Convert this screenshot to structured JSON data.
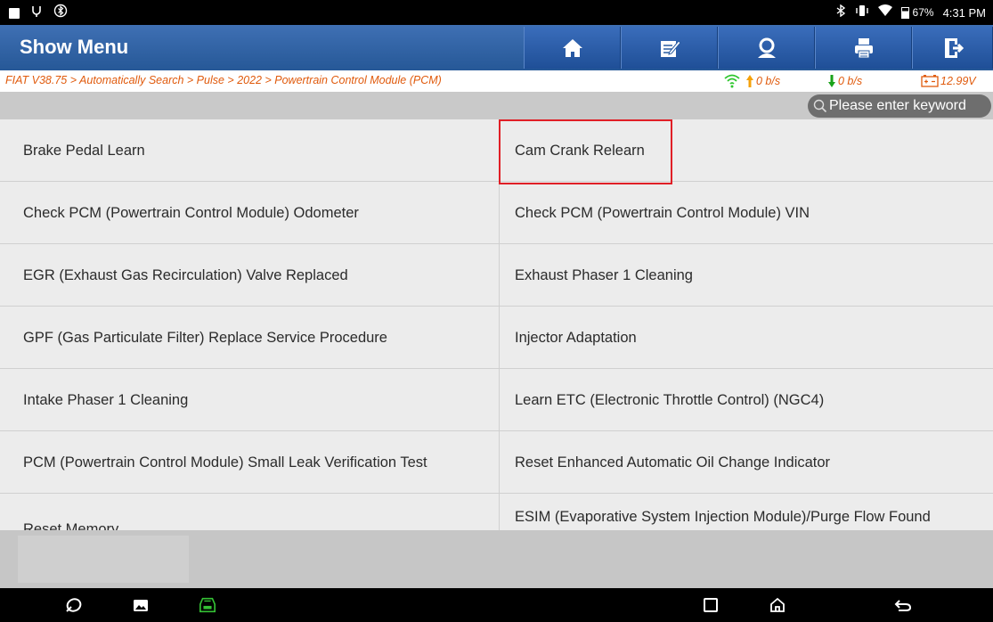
{
  "status_bar": {
    "icons_left": [
      "image-notification-icon",
      "usb-icon",
      "bluetooth-settings-icon"
    ],
    "icons_right": [
      "bluetooth-icon",
      "vibrate-icon",
      "wifi-icon",
      "battery-icon"
    ],
    "battery": "67%",
    "time": "4:31 PM"
  },
  "header": {
    "title": "Show Menu",
    "buttons": [
      "home-icon",
      "edit-report-icon",
      "user-icon",
      "print-icon",
      "exit-icon"
    ],
    "accent": "#2c5ea4"
  },
  "breadcrumb": {
    "path": "FIAT V38.75 > Automatically Search > Pulse > 2022 > Powertrain Control Module (PCM)",
    "upload_rate": "0 b/s",
    "download_rate": "0 b/s",
    "voltage": "12.99V",
    "color": "#e05a0c"
  },
  "search": {
    "placeholder": "Please enter keyword",
    "value": ""
  },
  "menu": {
    "items": [
      "Brake Pedal Learn",
      "Cam Crank Relearn",
      "Check PCM (Powertrain Control Module) Odometer",
      "Check PCM (Powertrain Control Module) VIN",
      "EGR (Exhaust Gas Recirculation) Valve Replaced",
      "Exhaust Phaser 1 Cleaning",
      "GPF (Gas Particulate Filter) Replace Service Procedure",
      "Injector Adaptation",
      "Intake Phaser 1 Cleaning",
      "Learn ETC (Electronic Throttle Control) (NGC4)",
      "PCM (Powertrain Control Module) Small Leak Verification Test",
      "Reset Enhanced Automatic Oil Change Indicator",
      "Reset Memory",
      "ESIM (Evaporative System Injection Module)/Purge Flow Found Monitor Test"
    ],
    "highlighted": "Cam Crank Relearn",
    "highlight_color": "#e01f26"
  },
  "nav_bar": {
    "buttons": [
      "browser-icon",
      "gallery-icon",
      "vci-icon",
      "recents-icon",
      "home-nav-icon",
      "back-icon"
    ]
  }
}
